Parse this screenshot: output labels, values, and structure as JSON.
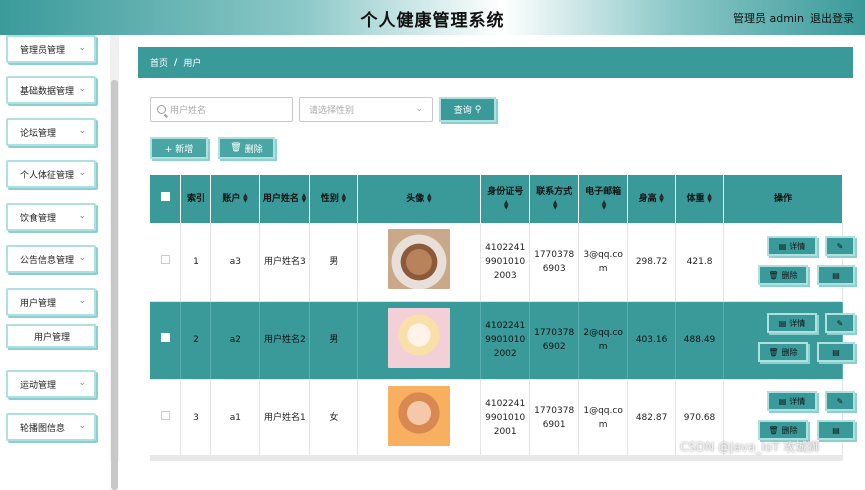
{
  "header": {
    "title": "个人健康管理系统",
    "admin": "管理员 admin",
    "logout": "退出登录"
  },
  "sidebar": {
    "items": [
      {
        "label": "管理员管理"
      },
      {
        "label": "基础数据管理"
      },
      {
        "label": "论坛管理"
      },
      {
        "label": "个人体征管理"
      },
      {
        "label": "饮食管理"
      },
      {
        "label": "公告信息管理"
      },
      {
        "label": "用户管理"
      },
      {
        "label": "运动管理"
      },
      {
        "label": "轮播图信息"
      }
    ],
    "sub_item": "用户管理"
  },
  "breadcrumb": {
    "home": "首页",
    "sep": "/",
    "current": "用户"
  },
  "search": {
    "placeholder": "用户姓名",
    "select_placeholder": "请选择性别",
    "query": "查询",
    "add": "+ 新增",
    "delete": "删除"
  },
  "table": {
    "headers": [
      "索引",
      "账户",
      "用户姓名",
      "性别",
      "头像",
      "身份证号",
      "联系方式",
      "电子邮箱",
      "身高",
      "体重",
      "操作"
    ],
    "rows": [
      {
        "index": "1",
        "account": "a3",
        "name": "用户姓名3",
        "gender": "男",
        "avatar": "cat",
        "id": "410224199010102003",
        "phone": "17703786903",
        "email": "3@qq.com",
        "height": "298.72",
        "weight": "421.8"
      },
      {
        "index": "2",
        "account": "a2",
        "name": "用户姓名2",
        "gender": "男",
        "avatar": "anime",
        "id": "410224199010102002",
        "phone": "17703786902",
        "email": "2@qq.com",
        "height": "403.16",
        "weight": "488.49"
      },
      {
        "index": "3",
        "account": "a1",
        "name": "用户姓名1",
        "gender": "女",
        "avatar": "girl",
        "id": "410224199010102001",
        "phone": "17703786901",
        "email": "1@qq.com",
        "height": "482.87",
        "weight": "970.68"
      }
    ],
    "op_detail": "详情",
    "op_delete": "删除"
  },
  "watermark": "CSDN @Java_IoT 攻城狮",
  "colors": {
    "accent": "#3a9a9a",
    "accent_light": "#aee0e0"
  }
}
